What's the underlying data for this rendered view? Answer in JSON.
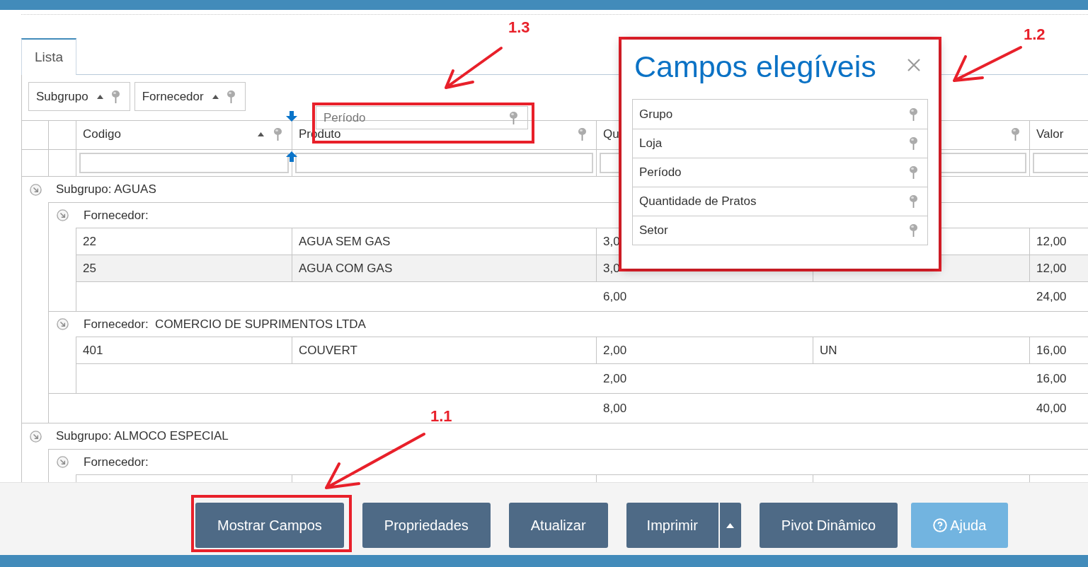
{
  "tabs": [
    {
      "label": "Lista",
      "selected": true
    }
  ],
  "group_panel": {
    "fields": [
      {
        "label": "Subgrupo",
        "sorted": true
      },
      {
        "label": "Fornecedor",
        "sorted": true
      }
    ]
  },
  "dragged_field": {
    "label": "Período"
  },
  "table": {
    "columns": {
      "codigo": {
        "label": "Codigo",
        "sorted": true
      },
      "produto": {
        "label": "Produto"
      },
      "column_3": {
        "label": "Qu"
      },
      "valor": {
        "label": "Valor"
      }
    },
    "groups": [
      {
        "label": "Subgrupo: AGUAS",
        "expanded": true,
        "suppliers": [
          {
            "label": "Fornecedor:",
            "expanded": true,
            "rows": [
              {
                "codigo": "22",
                "produto": "AGUA SEM GAS",
                "column_3": "3,0",
                "valor": "12,00"
              },
              {
                "codigo": "25",
                "produto": "AGUA COM GAS",
                "column_3": "3,0",
                "valor": "12,00"
              }
            ],
            "subtotal": {
              "column_3": "6,00",
              "valor": "24,00"
            }
          },
          {
            "label": "Fornecedor:  COMERCIO DE SUPRIMENTOS LTDA",
            "expanded": true,
            "rows": [
              {
                "codigo": "401",
                "produto": "COUVERT",
                "column_3": "2,00",
                "column_4": "UN",
                "valor": "16,00"
              }
            ],
            "subtotal": {
              "column_3": "2,00",
              "valor": "16,00"
            }
          }
        ],
        "subtotal": {
          "column_3": "8,00",
          "valor": "40,00"
        }
      },
      {
        "label": "Subgrupo: ALMOCO ESPECIAL",
        "expanded": true,
        "suppliers": [
          {
            "label": "Fornecedor:",
            "expanded": true
          }
        ]
      }
    ]
  },
  "fields_dialog": {
    "title": "Campos elegíveis",
    "items": [
      {
        "label": "Grupo"
      },
      {
        "label": "Loja"
      },
      {
        "label": "Período"
      },
      {
        "label": "Quantidade de Pratos"
      },
      {
        "label": "Setor"
      }
    ]
  },
  "footer": {
    "buttons": [
      {
        "label": "Mostrar Campos",
        "kind": "button"
      },
      {
        "label": "Propriedades",
        "kind": "button"
      },
      {
        "label": "Atualizar",
        "kind": "button"
      },
      {
        "label": "Imprimir",
        "kind": "split"
      },
      {
        "label": "Pivot Dinâmico",
        "kind": "button"
      },
      {
        "label": "Ajuda",
        "kind": "help"
      }
    ]
  },
  "annotations": [
    {
      "label": "1.3"
    },
    {
      "label": "1.2"
    },
    {
      "label": "1.1"
    }
  ]
}
